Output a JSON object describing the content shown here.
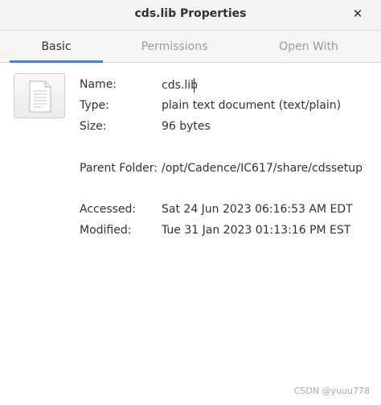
{
  "window": {
    "title": "cds.lib Properties",
    "close_glyph": "✕"
  },
  "tabs": [
    {
      "label": "Basic",
      "active": true
    },
    {
      "label": "Permissions",
      "active": false
    },
    {
      "label": "Open With",
      "active": false
    }
  ],
  "file_icon": "text-document-icon",
  "fields": {
    "name_label": "Name:",
    "name_value": "cds.lib",
    "type_label": "Type:",
    "type_value": "plain text document (text/plain)",
    "size_label": "Size:",
    "size_value": "96 bytes",
    "parent_label": "Parent Folder:",
    "parent_value": "/opt/Cadence/IC617/share/cdssetup",
    "accessed_label": "Accessed:",
    "accessed_value": "Sat 24 Jun 2023 06:16:53 AM EDT",
    "modified_label": "Modified:",
    "modified_value": "Tue 31 Jan 2023 01:13:16 PM EST"
  },
  "watermark": "CSDN @yuuu778",
  "colors": {
    "accent": "#3584e4",
    "text": "#2e3436",
    "inactive_tab": "#999c9a"
  }
}
